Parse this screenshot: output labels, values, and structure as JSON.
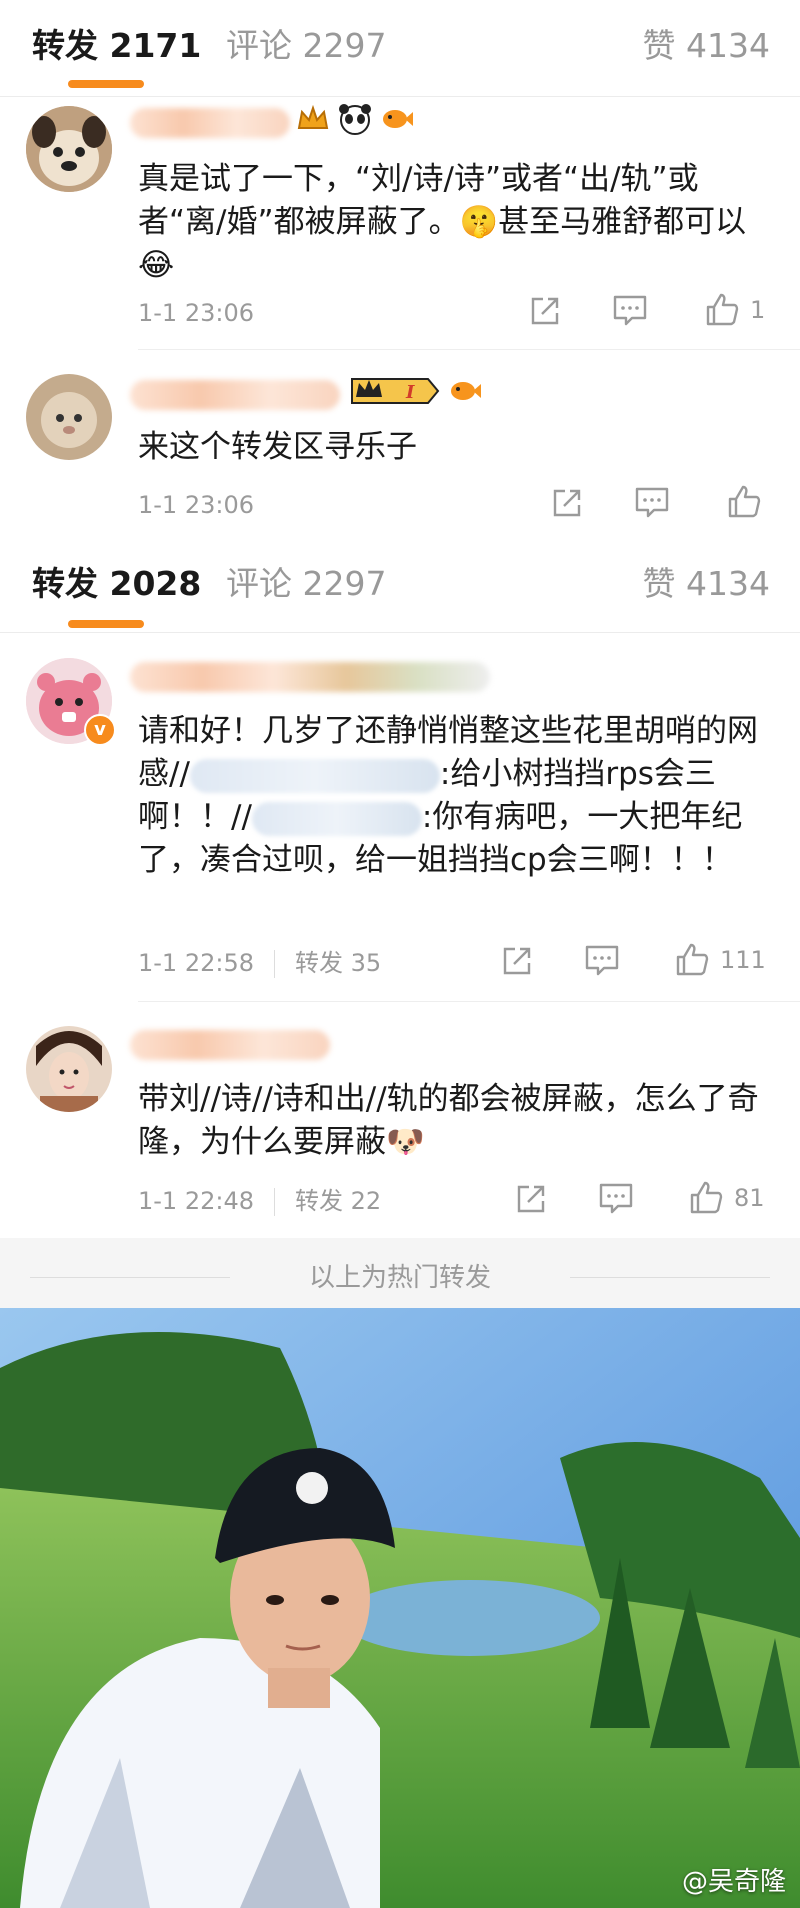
{
  "top_tabs": {
    "repost": "转发 2171",
    "comments": "评论 2297",
    "likes": "赞 4134"
  },
  "comment1": {
    "text": "真是试了一下，“刘/诗/诗”或者“出/轨”或者“离/婚”都被屏蔽了。🤫甚至马雅舒都可以😂",
    "time": "1-1 23:06",
    "like_count": "1"
  },
  "comment2": {
    "text": "来这个转发区寻乐子",
    "time": "1-1 23:06"
  },
  "second_tabs": {
    "repost": "转发 2028",
    "comments": "评论 2297",
    "likes": "赞 4134"
  },
  "repost1": {
    "text_a": "请和好！几岁了还静悄悄整这些花里胡哨的网感//",
    "text_b": ":给小树挡挡rps会三啊！！//",
    "text_c": ":你有病吧，一大把年纪了，凑合过呗，给一姐挡挡cp会三啊！！！",
    "time": "1-1 22:58",
    "repost_count": "转发 35",
    "like_count": "111"
  },
  "repost2": {
    "text": "带刘//诗//诗和出//轨的都会被屏蔽，怎么了奇隆，为什么要屏蔽🐶",
    "time": "1-1 22:48",
    "repost_count": "转发 22",
    "like_count": "81"
  },
  "hot_repost_label": "以上为热门转发",
  "photo": {
    "watermark": "@吴奇隆"
  },
  "icons": [
    "share-icon",
    "comment-icon",
    "like-icon",
    "crown-icon",
    "panda-icon",
    "fish-icon",
    "verified-icon"
  ],
  "colors": {
    "accent": "#f78b1d",
    "muted": "#9a9a9a",
    "text": "#1a1a1a"
  }
}
